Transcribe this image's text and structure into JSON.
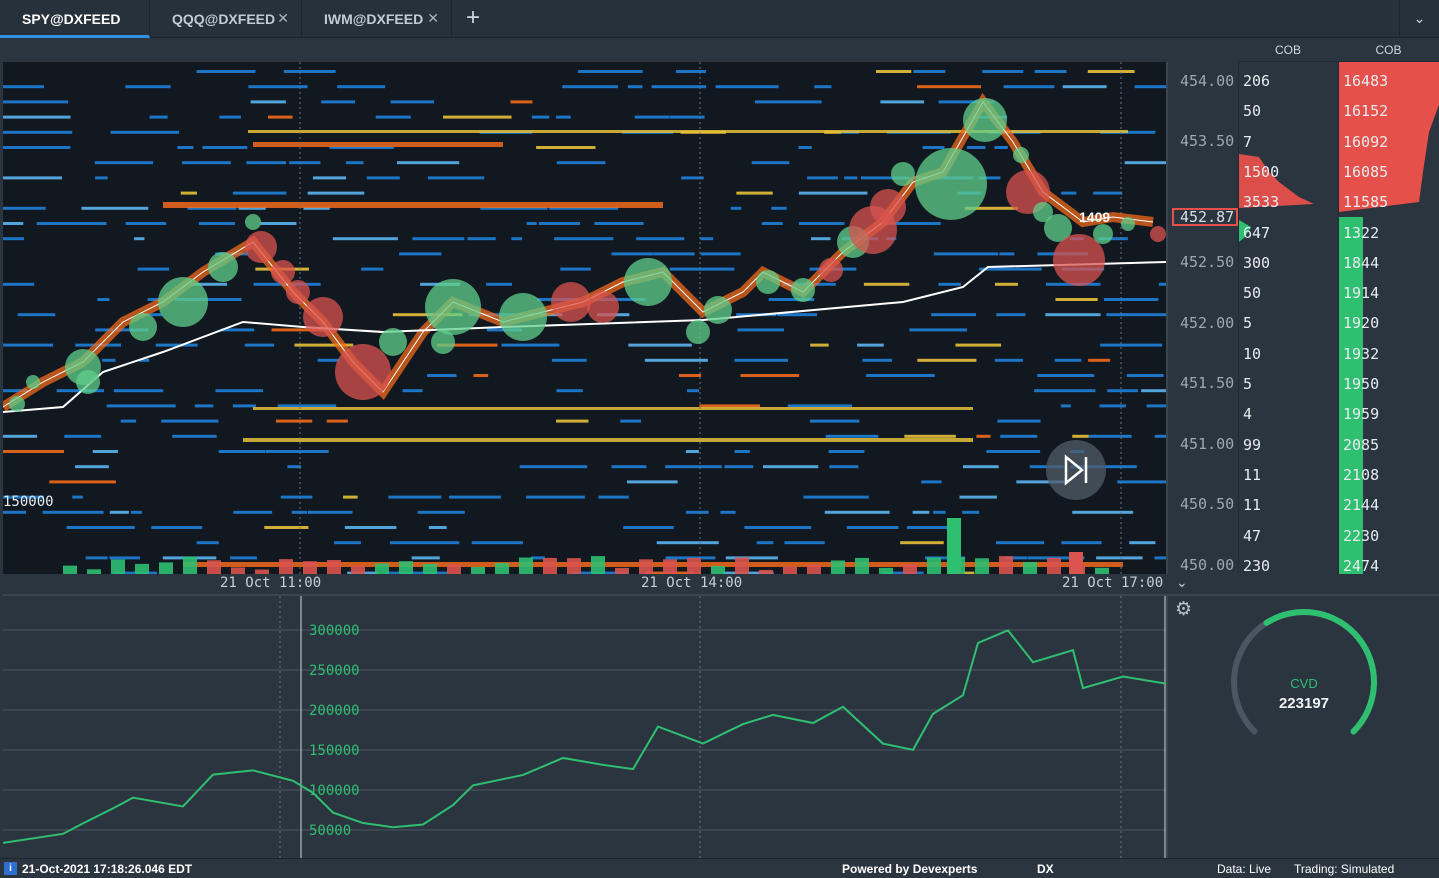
{
  "tabs": [
    {
      "label": "SPY@DXFEED",
      "active": true
    },
    {
      "label": "QQQ@DXFEED",
      "active": false
    },
    {
      "label": "IWM@DXFEED",
      "active": false
    }
  ],
  "tab_close_glyph": "✕",
  "add_tab_glyph": "+",
  "menu_glyph": "⌄",
  "cob_headers": [
    "COB",
    "COB"
  ],
  "price_ticks": [
    "454.00",
    "453.50",
    "452.50",
    "452.00",
    "451.50",
    "451.00",
    "450.50",
    "450.00"
  ],
  "current_price": "452.87",
  "last_trade_label": "1409",
  "volume_scale_label": "150000",
  "time_ticks": [
    "21 Oct 11:00",
    "21 Oct 14:00",
    "21 Oct 17:00"
  ],
  "cob_left": [
    "206",
    "50",
    "7",
    "1500",
    "3533",
    "647",
    "300",
    "50",
    "5",
    "10",
    "5",
    "4",
    "99",
    "11",
    "11",
    "47",
    "230"
  ],
  "cob_right": [
    "16483",
    "16152",
    "16092",
    "16085",
    "11585",
    "1322",
    "1844",
    "1914",
    "1920",
    "1932",
    "1950",
    "1959",
    "2085",
    "2108",
    "2144",
    "2230",
    "2474"
  ],
  "cvd_ticks": [
    "300000",
    "250000",
    "200000",
    "150000",
    "100000",
    "50000"
  ],
  "cvd": {
    "label": "CVD",
    "value": "223197",
    "gauge_fraction": 0.62
  },
  "status": {
    "timestamp": "21-Oct-2021 17:18:26.046 EDT",
    "powered": "Powered by Devexperts",
    "dx": "DX",
    "data": "Data: Live",
    "trading": "Trading: Simulated"
  },
  "icons": [
    "info-icon",
    "close-icon",
    "plus-icon",
    "chevron-down-icon",
    "gear-icon",
    "skip-forward-icon"
  ],
  "colors": {
    "bid": "#2fbf71",
    "ask": "#e5504a",
    "accent": "#2f8fe0"
  }
}
